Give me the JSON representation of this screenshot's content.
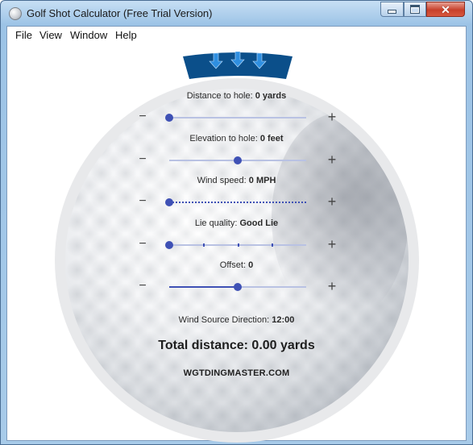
{
  "window": {
    "title": "Golf Shot Calculator (Free Trial Version)",
    "minimize_icon": "minimize-icon",
    "maximize_icon": "maximize-icon",
    "close_icon": "close-icon"
  },
  "menu": {
    "items": [
      {
        "label": "File"
      },
      {
        "label": "View"
      },
      {
        "label": "Window"
      },
      {
        "label": "Help"
      }
    ]
  },
  "wind_indicator": {
    "icon": "wind-arrows-icon",
    "color": "#0b4f8a"
  },
  "sliders": {
    "distance": {
      "label": "Distance to hole:",
      "value": "0 yards",
      "fraction": 0.0
    },
    "elevation": {
      "label": "Elevation to hole:",
      "value": "0 feet",
      "fraction": 0.5
    },
    "wind": {
      "label": "Wind speed:",
      "value": "0 MPH",
      "fraction": 0.0
    },
    "lie": {
      "label": "Lie quality:",
      "value": "Good Lie",
      "fraction": 0.0
    },
    "offset": {
      "label": "Offset:",
      "value": "0",
      "fraction": 0.5
    },
    "minus_symbol": "−",
    "plus_symbol": "+"
  },
  "wind_source": {
    "label": "Wind Source Direction:",
    "value": "12:00"
  },
  "total": {
    "text": "Total distance: 0.00 yards"
  },
  "brand": {
    "text": "WGTDINGMASTER.COM"
  },
  "colors": {
    "accent": "#3f51b5",
    "track": "#b9c2e3"
  }
}
